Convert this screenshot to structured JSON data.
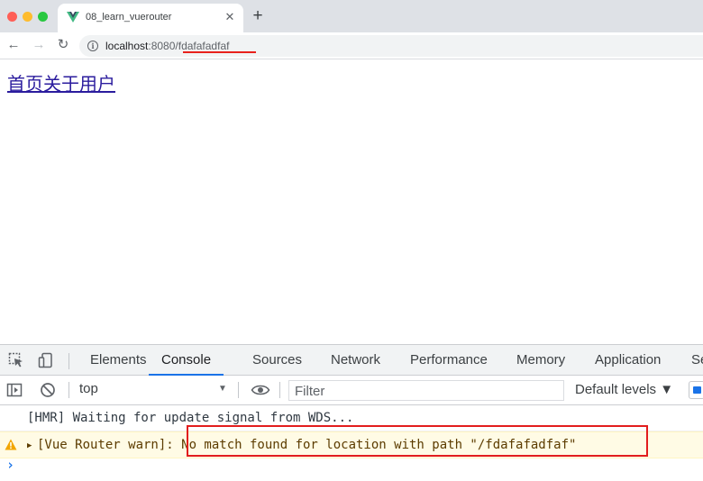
{
  "browser": {
    "tab": {
      "title": "08_learn_vuerouter",
      "close_glyph": "✕",
      "favicon": "vue-logo-icon"
    },
    "new_tab_glyph": "+",
    "nav": {
      "back": "←",
      "forward": "→",
      "reload": "↻"
    },
    "address": {
      "host": "localhost",
      "rest": ":8080/fdafafadfaf"
    }
  },
  "page": {
    "links": [
      "首页",
      "关于",
      "用户"
    ]
  },
  "devtools": {
    "tabs": [
      "Elements",
      "Console",
      "Sources",
      "Network",
      "Performance",
      "Memory",
      "Application",
      "Se"
    ],
    "active_tab": "Console",
    "console_bar": {
      "context": "top",
      "context_arrow": "▼",
      "filter_placeholder": "Filter",
      "levels": "Default levels ▼"
    },
    "messages": {
      "hmr": "[HMR] Waiting for update signal from WDS...",
      "warn_toggle": "▶",
      "warn": "[Vue Router warn]: No match found for location with path \"/fdafafadfaf\""
    },
    "prompt": "›"
  },
  "colors": {
    "accent": "#1a73e8",
    "annotation": "#e21d1d",
    "warn_bg": "#fffbe5",
    "warn_text": "#5c3c00",
    "link": "#2b1c9e"
  }
}
